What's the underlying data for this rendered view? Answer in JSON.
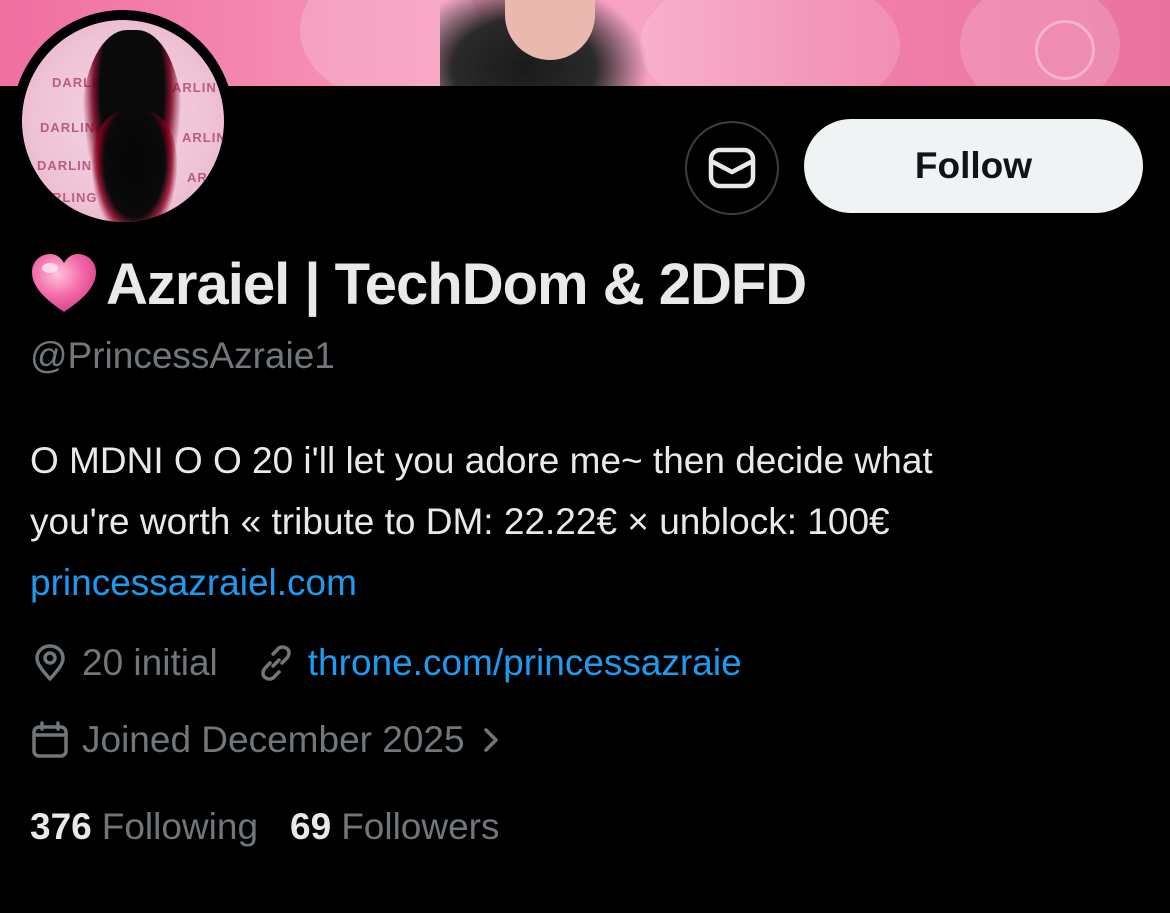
{
  "header": {
    "banner_alt": "profile banner",
    "avatar_text": "DARLING"
  },
  "actions": {
    "dm_icon": "mail-icon",
    "follow_label": "Follow"
  },
  "profile": {
    "display_name": "Azraiel | TechDom & 2DFD",
    "name_emoji": "pink-heart",
    "handle": "@PrincessAzraie1",
    "bio_line1": "O MDNI O O 20 i'll let you adore me~ then decide what",
    "bio_line2": "you're worth « tribute to DM: 22.22€ × unblock: 100€",
    "bio_link": "princessazraiel.com",
    "location": "20 initial",
    "website": "throne.com/princessazraie",
    "joined": "Joined December 2025",
    "following_count": "376",
    "following_label": "Following",
    "followers_count": "69",
    "followers_label": "Followers"
  },
  "colors": {
    "background": "#000000",
    "text_primary": "#e7e9ea",
    "text_secondary": "#71767b",
    "link": "#1d9bf0",
    "follow_bg": "#eff3f4",
    "banner_pink": "#f590b6"
  }
}
